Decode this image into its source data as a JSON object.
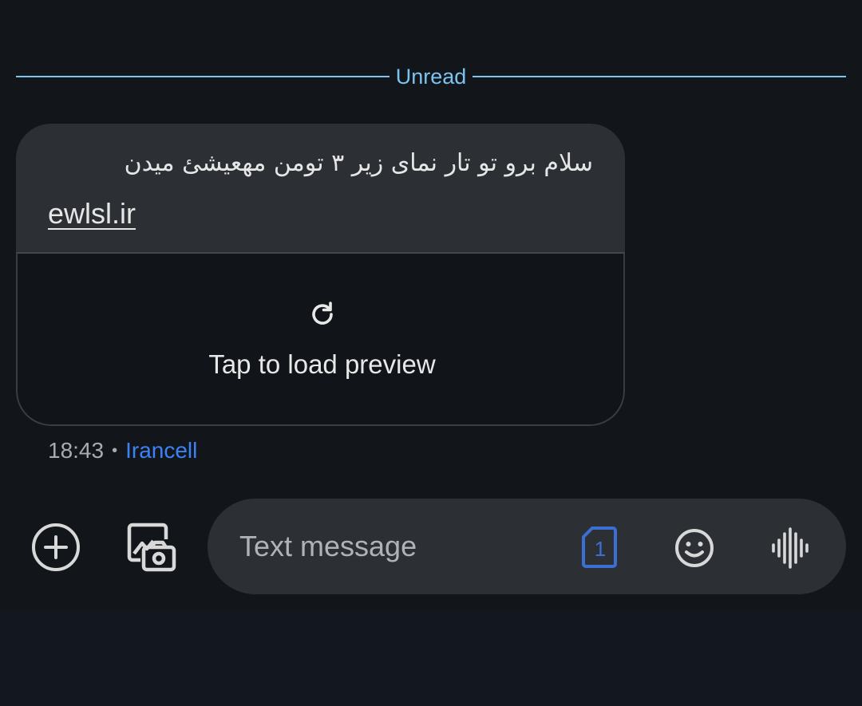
{
  "divider": {
    "label": "Unread"
  },
  "message": {
    "text": "سلام برو تو تار نمای زیر ۳ تومن مهعیشئ میدن",
    "link": "ewlsl.ir",
    "preview_label": "Tap to load preview",
    "time": "18:43",
    "separator": "•",
    "carrier": "Irancell"
  },
  "compose": {
    "placeholder": "Text message",
    "sim_number": "1"
  },
  "colors": {
    "accent_blue": "#7cc4f0",
    "carrier_blue": "#3b82f6",
    "sim_blue": "#3b6fd4"
  },
  "icons": {
    "add": "add-circle-icon",
    "gallery": "gallery-camera-icon",
    "reload": "reload-icon",
    "sim": "sim-card-icon",
    "emoji": "emoji-icon",
    "voice": "voice-waveform-icon"
  }
}
